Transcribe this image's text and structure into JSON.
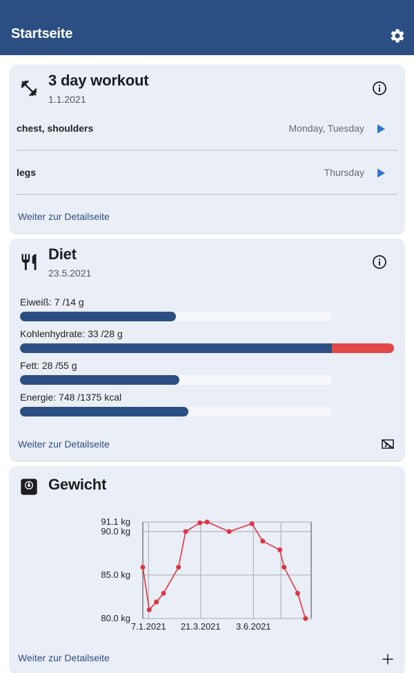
{
  "appbar": {
    "title": "Startseite",
    "settings_icon": "gear-icon"
  },
  "workout": {
    "icon": "dumbbell-icon",
    "title": "3 day workout",
    "date": "1.1.2021",
    "rows": [
      {
        "name": "chest, shoulders",
        "days": "Monday, Tuesday"
      },
      {
        "name": "legs",
        "days": "Thursday"
      }
    ],
    "link": "Weiter zur Detailseite"
  },
  "diet": {
    "icon": "cutlery-icon",
    "title": "Diet",
    "date": "23.5.2021",
    "macros": [
      {
        "label": "Eiweiß: 7 /14 g",
        "fraction": 0.5
      },
      {
        "label": "Kohlenhydrate: 33 /28 g",
        "fraction": 1.18
      },
      {
        "label": "Fett: 28 /55 g",
        "fraction": 0.51
      },
      {
        "label": "Energie: 748 /1375 kcal",
        "fraction": 0.54
      }
    ],
    "link": "Weiter zur Detailseite",
    "colors": {
      "bar": "#2b4f83",
      "over": "#e24848",
      "track": "#f6f7fa"
    }
  },
  "weight": {
    "icon": "scale-icon",
    "title": "Gewicht",
    "link": "Weiter zur Detailseite",
    "add_icon": "plus-icon"
  },
  "chart_data": {
    "type": "line",
    "title": "",
    "xlabel": "",
    "ylabel": "",
    "y_tick_labels": [
      "80.0 kg",
      "85.0 kg",
      "90.0 kg",
      "91.1 kg"
    ],
    "y_ticks": [
      80.0,
      85.0,
      90.0,
      91.1
    ],
    "x_tick_labels": [
      "7.1.2021",
      "21.3.2021",
      "3.6.2021"
    ],
    "x_ticks": [
      "2021-01-07",
      "2021-03-21",
      "2021-06-03"
    ],
    "xlim": [
      "2020-12-30",
      "2021-08-23"
    ],
    "ylim": [
      80.0,
      91.1
    ],
    "grid": true,
    "color": "#e0333f",
    "series": [
      {
        "x": [
          "2020-12-30",
          "2021-01-08",
          "2021-01-18",
          "2021-01-28",
          "2021-02-18",
          "2021-02-28",
          "2021-03-20",
          "2021-03-30",
          "2021-04-30",
          "2021-06-01",
          "2021-06-16",
          "2021-07-10",
          "2021-07-16",
          "2021-08-04",
          "2021-08-15"
        ],
        "y": [
          85.9,
          81.0,
          81.9,
          82.9,
          85.9,
          90.0,
          91.0,
          91.1,
          90.0,
          90.9,
          88.9,
          87.9,
          85.9,
          82.9,
          80.0
        ]
      }
    ]
  }
}
